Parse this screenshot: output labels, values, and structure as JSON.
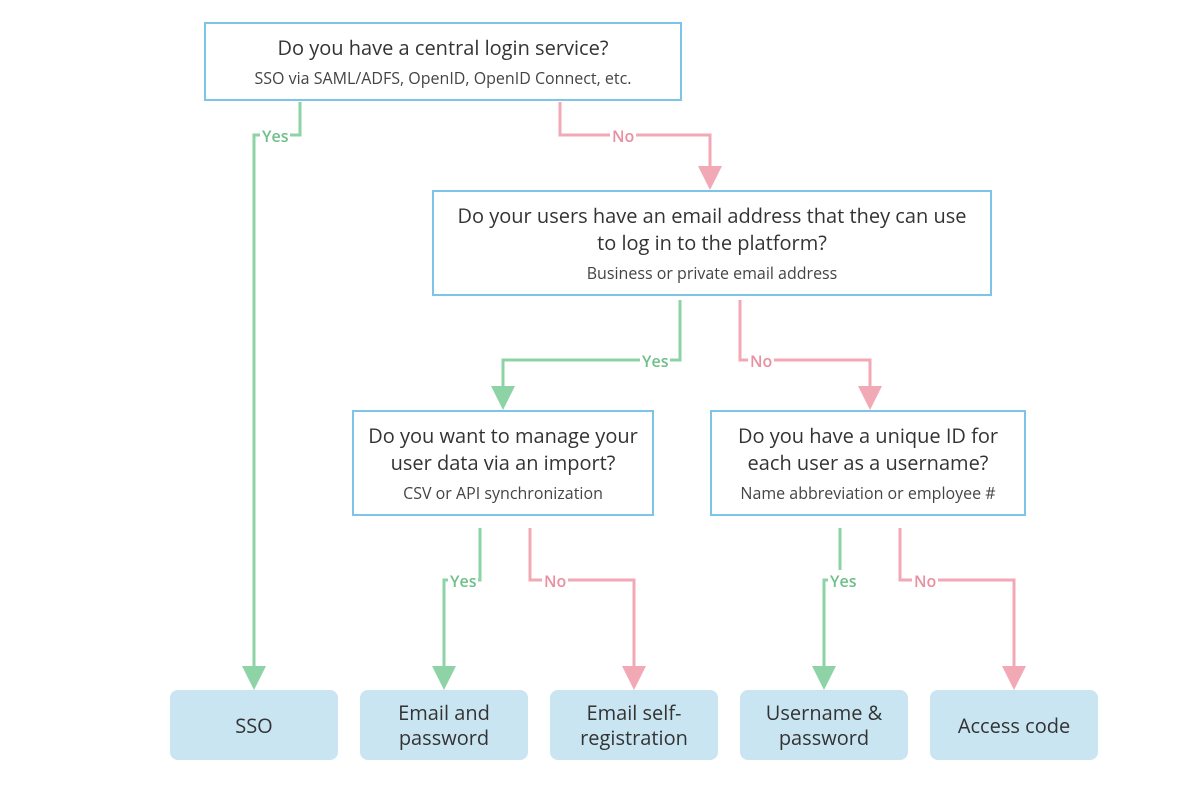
{
  "colors": {
    "node_border": "#7cc5e8",
    "leaf_bg": "#c9e5f2",
    "yes": "#8dd3a6",
    "no": "#f0a9b5"
  },
  "labels": {
    "yes": "Yes",
    "no": "No"
  },
  "flow": {
    "root": {
      "question": "Do you have a central login service?",
      "subtitle": "SSO via SAML/ADFS, OpenID, OpenID Connect, etc.",
      "yes_leads_to": "leaf_sso",
      "no_leads_to": "q_email"
    },
    "q_email": {
      "question": "Do your users have an email address that they can use to log in to the platform?",
      "subtitle": "Business or private email address",
      "yes_leads_to": "q_import",
      "no_leads_to": "q_unique_id"
    },
    "q_import": {
      "question": "Do you want to manage your user data via an import?",
      "subtitle": "CSV or API synchronization",
      "yes_leads_to": "leaf_email_pw",
      "no_leads_to": "leaf_email_selfreg"
    },
    "q_unique_id": {
      "question": "Do you have a unique ID for each user as a username?",
      "subtitle": "Name abbreviation or employee #",
      "yes_leads_to": "leaf_username_pw",
      "no_leads_to": "leaf_access_code"
    }
  },
  "leaves": {
    "leaf_sso": "SSO",
    "leaf_email_pw": "Email and password",
    "leaf_email_selfreg": "Email self-registration",
    "leaf_username_pw": "Username & password",
    "leaf_access_code": "Access code"
  }
}
